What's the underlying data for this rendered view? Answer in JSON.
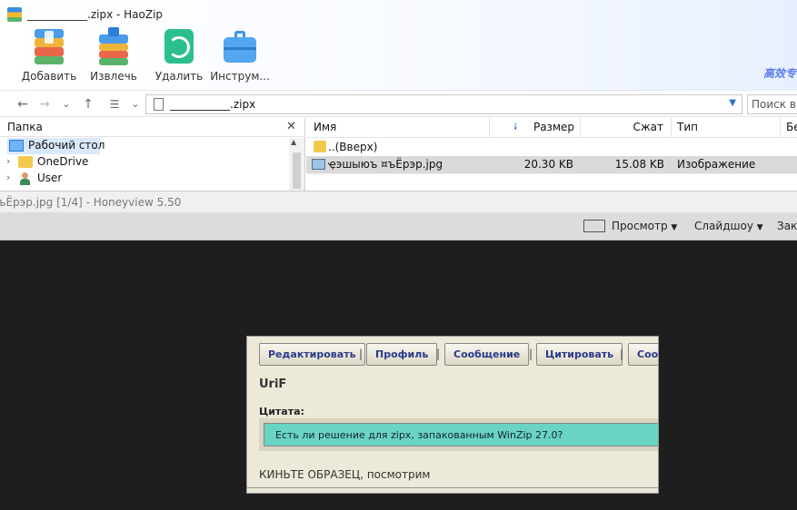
{
  "haozip": {
    "title": "___________.zipx - HaoZip",
    "brand": "高效专",
    "toolbar": [
      {
        "label": "Добавить",
        "icon": "add-archive-icon"
      },
      {
        "label": "Извлечь",
        "icon": "extract-archive-icon"
      },
      {
        "label": "Удалить",
        "icon": "recycle-bin-icon"
      },
      {
        "label": "Инструм...",
        "icon": "toolbox-icon"
      }
    ],
    "address": "___________.zipx",
    "search_placeholder": "Поиск в",
    "left_pane": {
      "title": "Папка",
      "items": [
        {
          "label": "Рабочий стол",
          "icon": "desktop-icon",
          "selected": true
        },
        {
          "label": "OneDrive",
          "icon": "folder-icon"
        },
        {
          "label": "User",
          "icon": "user-icon"
        }
      ]
    },
    "columns": [
      "Имя",
      "Размер",
      "Сжат",
      "Тип",
      "Бе"
    ],
    "rows": [
      {
        "name": "..(Вверх)",
        "size": "",
        "packed": "",
        "type": "",
        "icon": "folder-icon"
      },
      {
        "name": "ҿэшыюъ ¤ъЁрэр.jpg",
        "size": "20.30 KB",
        "packed": "15.08 KB",
        "type": "Изображение",
        "icon": "image-file-icon"
      }
    ]
  },
  "honeyview": {
    "title": "ъЁрэр.jpg [1/4] - Honeyview 5.50",
    "toolbar": {
      "view": "Просмотр",
      "slideshow": "Слайдшоу",
      "bookmarks": "Зак"
    }
  },
  "forum": {
    "buttons": [
      "Редактировать",
      "Профиль",
      "Сообщение",
      "Цитировать",
      "Сооб"
    ],
    "username": "UriF",
    "quote_label": "Цитата:",
    "quote_text": "Есть ли решение для zipx, запакованным WinZip 27.0?",
    "body": "КИНЬТЕ ОБРАЗЕЦ, посмотрим"
  },
  "colors": {
    "viewer_bg": "#1e1e1e",
    "selected_row": "#d9d9d9",
    "quote_bg": "#6ad4c2",
    "forum_bg": "#ece9d8",
    "forum_button_text": "#2a3a8a"
  }
}
